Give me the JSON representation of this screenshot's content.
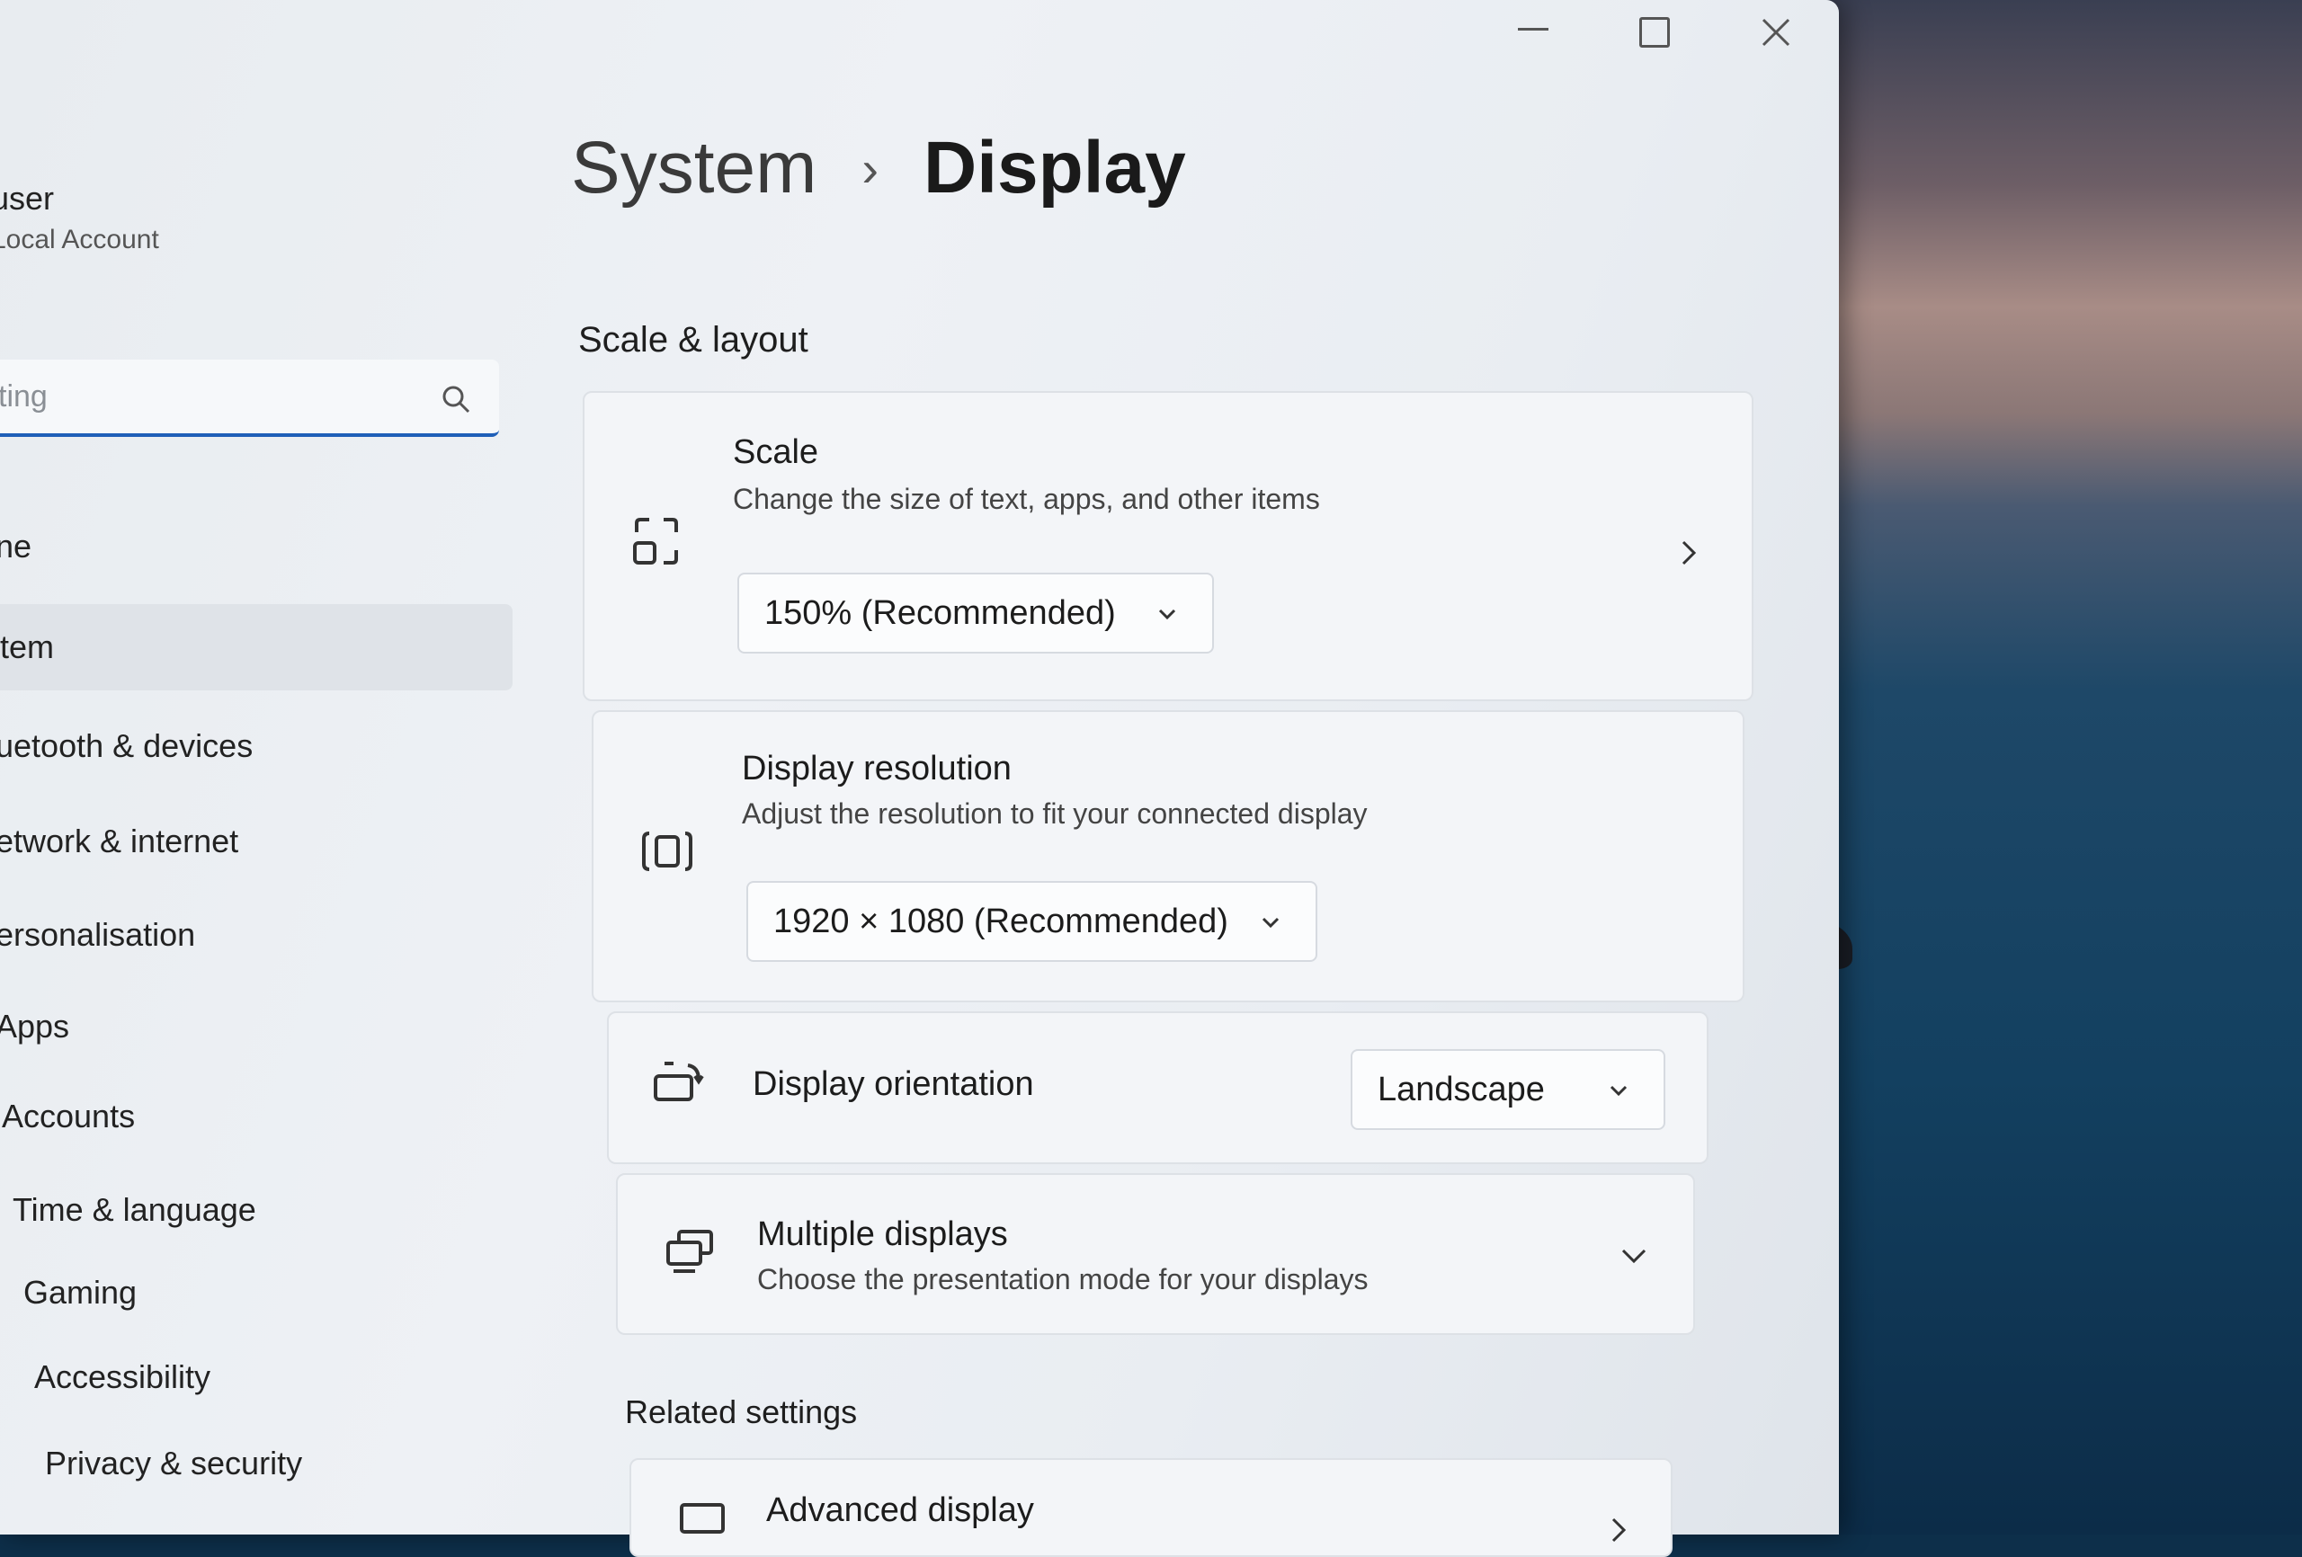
{
  "window": {
    "controls": {
      "minimize": "minimize",
      "maximize": "maximize",
      "close": "close"
    }
  },
  "sidebar": {
    "user_name": "user",
    "user_account": "Local Account",
    "search_placeholder": "ting",
    "items": [
      {
        "label": "ne"
      },
      {
        "label": "tem",
        "selected": true
      },
      {
        "label": "uetooth & devices"
      },
      {
        "label": "etwork & internet"
      },
      {
        "label": "ersonalisation"
      },
      {
        "label": "Apps"
      },
      {
        "label": "Accounts"
      },
      {
        "label": "Time & language"
      },
      {
        "label": "Gaming"
      },
      {
        "label": "Accessibility"
      },
      {
        "label": "Privacy & security"
      }
    ]
  },
  "breadcrumb": {
    "parent": "System",
    "separator": "›",
    "current": "Display"
  },
  "scale_layout": {
    "title": "Scale & layout",
    "scale": {
      "title": "Scale",
      "description": "Change the size of text, apps, and other items",
      "value": "150% (Recommended)"
    },
    "resolution": {
      "title": "Display resolution",
      "description": "Adjust the resolution to fit your connected display",
      "value": "1920 × 1080 (Recommended)"
    },
    "orientation": {
      "title": "Display orientation",
      "value": "Landscape"
    },
    "multiple": {
      "title": "Multiple displays",
      "description": "Choose the presentation mode for your displays"
    }
  },
  "related": {
    "title": "Related settings",
    "advanced": {
      "title": "Advanced display"
    }
  },
  "colors": {
    "accent": "#1f5fb8",
    "window_bg": "#eef1f5",
    "card_bg": "#f3f5f8"
  }
}
